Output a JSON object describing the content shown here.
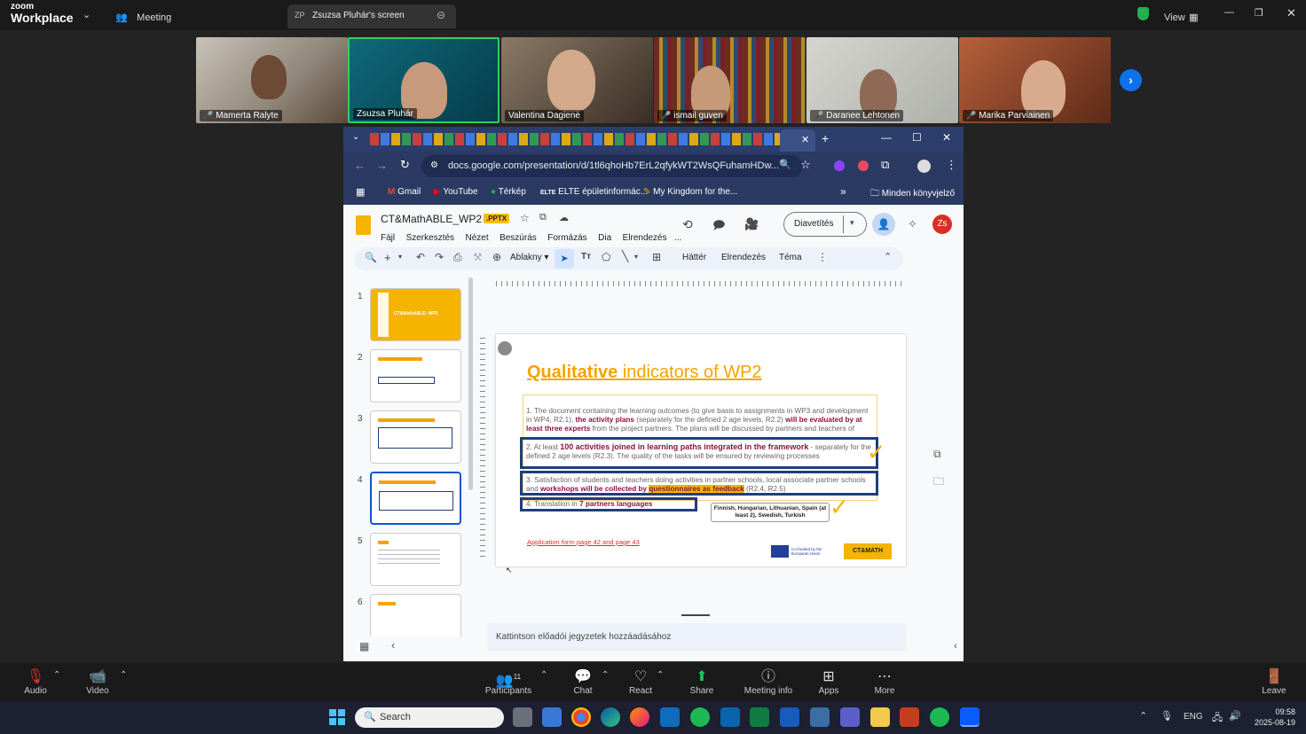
{
  "zoom": {
    "logo_top": "zoom",
    "logo_bottom": "Workplace",
    "meeting_label": "Meeting",
    "share_tab_initials": "ZP",
    "share_tab_label": "Zsuzsa Pluhár's screen",
    "view_label": "View"
  },
  "participants": [
    {
      "name": "Mamerta Ralyte",
      "muted": true
    },
    {
      "name": "Zsuzsa Pluhár",
      "muted": false
    },
    {
      "name": "Valentina Dagienė",
      "muted": false
    },
    {
      "name": "ismail guven",
      "muted": true
    },
    {
      "name": "Daranee Lehtonen",
      "muted": true
    },
    {
      "name": "Marika Parviainen",
      "muted": true
    }
  ],
  "browser": {
    "url": "docs.google.com/presentation/d/1tl6qhoHb7ErL2qfykWT2WsQFuhamHDw...",
    "bookmarks": [
      "Gmail",
      "YouTube",
      "Térkép",
      "ELTE épületinformác...",
      "My Kingdom for the..."
    ],
    "bookmarks_folder": "Minden könyvjelző"
  },
  "slides": {
    "doc_title": "CT&MathABLE_WP2",
    "badge": ".PPTX",
    "menu": [
      "Fájl",
      "Szerkesztés",
      "Nézet",
      "Beszúrás",
      "Formázás",
      "Dia",
      "Elrendezés",
      "..."
    ],
    "present_label": "Diavetítés",
    "avatar_initials": "Zs",
    "toolbar": {
      "zoom": "Ablakny",
      "background": "Háttér",
      "layout": "Elrendezés",
      "theme": "Téma"
    },
    "thumb_numbers": [
      "1",
      "2",
      "3",
      "4",
      "5",
      "6"
    ],
    "thumb1_title": "CT&MathABLE: WP2",
    "notes_placeholder": "Kattintson előadói jegyzetek hozzáadásához"
  },
  "slide": {
    "title_bold": "Qualitative",
    "title_rest": " indicators of WP2",
    "item1_a": "The document containing the learning outcomes (to give basis to assignments in WP3 and development in WP4, R2.1), ",
    "item1_b": "the activity plans",
    "item1_c": " (separately for the defined 2 age levels, R2.2) ",
    "item1_d": "will be evaluated by at least three experts",
    "item1_e": " from the project partners. The plans will be discussed by partners and teachers of associated schools in Hungary (Teacher Workshop R 2.6)",
    "item2_a": "At least ",
    "item2_b": "100 activities joined in learning paths integrated in the framework",
    "item2_c": " - separately for the defined 2 age levels (R2.3). The quality of the tasks will be ensured by reviewing processes",
    "item3_a": "Satisfaction of students and teachers doing activities in partner schools, local associate partner schools and ",
    "item3_b": "workshops will be collected by ",
    "item3_c": "questionnaires as feedback",
    "item3_d": " (R2.4, R2.5)",
    "item4_a": "Translation in ",
    "item4_b": "7 partners languages",
    "callout": "Finnish, Hungarian, Lithuanian, Spain (at least 2), Swedish, Turkish",
    "link": "Application form page 42 and page 43",
    "eu_text": "Co-funded by the European Union",
    "logo_text": "CT&MATH"
  },
  "bottom_toolbar": {
    "audio": "Audio",
    "video": "Video",
    "participants": "Participants",
    "participants_count": "11",
    "chat": "Chat",
    "react": "React",
    "share": "Share",
    "meeting_info": "Meeting info",
    "apps": "Apps",
    "more": "More",
    "leave": "Leave"
  },
  "taskbar": {
    "search_placeholder": "Search",
    "lang": "ENG",
    "time": "09:58",
    "date": "2025-08-19"
  },
  "colors": {
    "slide_title": "#f4a300",
    "highlight_text": "#8b1346",
    "box_border": "#1f3f7a",
    "check": "#f4b400"
  }
}
